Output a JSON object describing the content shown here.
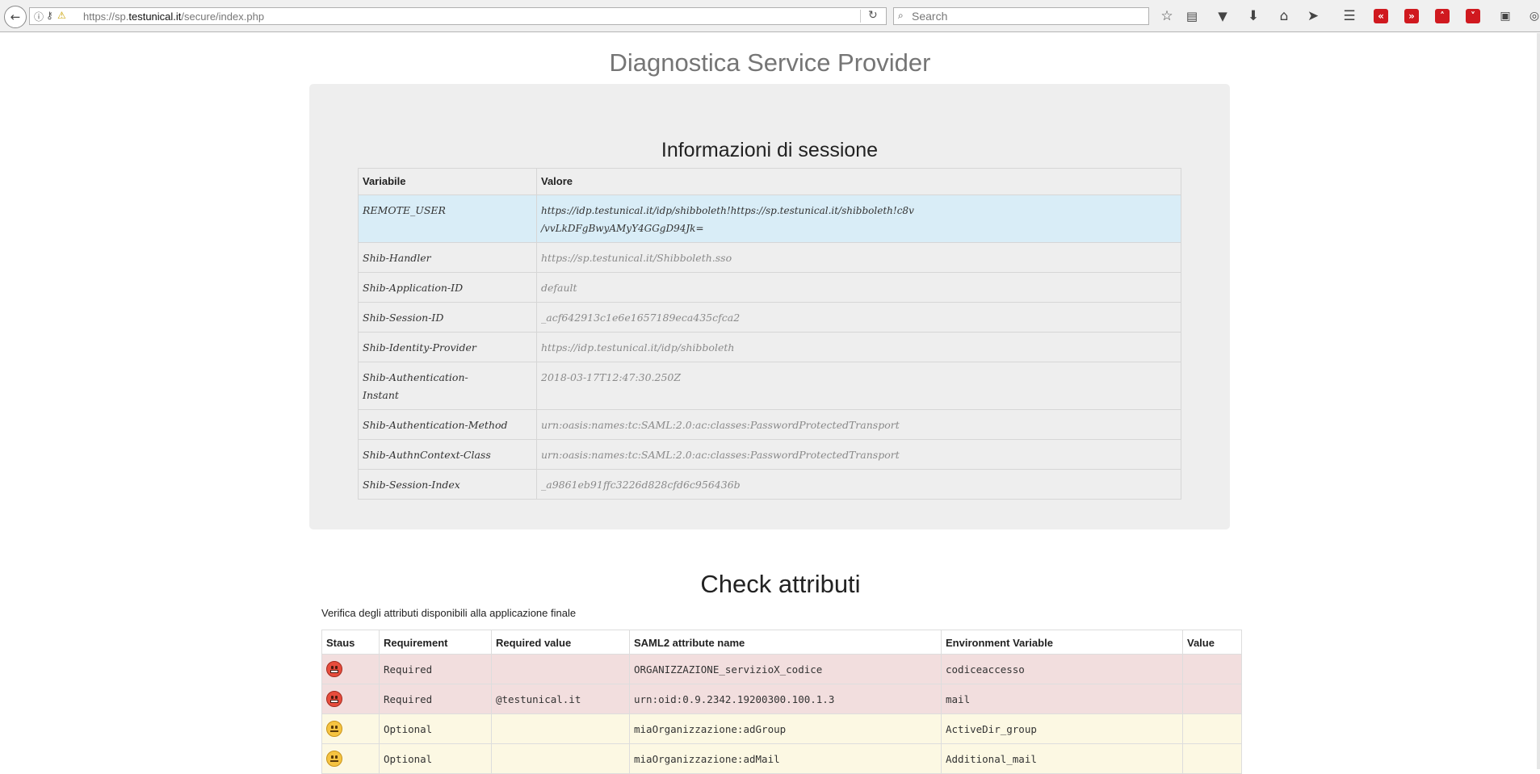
{
  "browser": {
    "url_prefix": "https://sp.",
    "url_host": "testunical.it",
    "url_path": "/secure/index.php",
    "search_placeholder": "Search"
  },
  "page": {
    "title": "Diagnostica Service Provider"
  },
  "session": {
    "heading": "Informazioni di sessione",
    "columns": [
      "Variabile",
      "Valore"
    ],
    "rows": [
      {
        "var": "REMOTE_USER",
        "val": "https://idp.testunical.it/idp/shibboleth!https://sp.testunical.it/shibboleth!c8v\n/vvLkDFgBwyAMyY4GGgD94Jk="
      },
      {
        "var": "Shib-Handler",
        "val": "https://sp.testunical.it/Shibboleth.sso"
      },
      {
        "var": "Shib-Application-ID",
        "val": "default"
      },
      {
        "var": "Shib-Session-ID",
        "val": "_acf642913c1e6e1657189eca435cfca2"
      },
      {
        "var": "Shib-Identity-Provider",
        "val": "https://idp.testunical.it/idp/shibboleth"
      },
      {
        "var": "Shib-Authentication-\nInstant",
        "val": "2018-03-17T12:47:30.250Z"
      },
      {
        "var": "Shib-Authentication-Method",
        "val": "urn:oasis:names:tc:SAML:2.0:ac:classes:PasswordProtectedTransport"
      },
      {
        "var": "Shib-AuthnContext-Class",
        "val": "urn:oasis:names:tc:SAML:2.0:ac:classes:PasswordProtectedTransport"
      },
      {
        "var": "Shib-Session-Index",
        "val": "_a9861eb91ffc3226d828cfd6c956436b"
      }
    ]
  },
  "check": {
    "heading": "Check attributi",
    "subtitle": "Verifica degli attributi disponibili alla applicazione finale",
    "columns": [
      "Staus",
      "Requirement",
      "Required value",
      "SAML2 attribute name",
      "Environment Variable",
      "Value"
    ],
    "rows": [
      {
        "status_icon": "sad-face-icon",
        "requirement": "Required",
        "required_value": "",
        "saml2_name": "ORGANIZZAZIONE_servizioX_codice",
        "env_var": "codiceaccesso",
        "value": ""
      },
      {
        "status_icon": "sad-face-icon",
        "requirement": "Required",
        "required_value": "@testunical.it",
        "saml2_name": "urn:oid:0.9.2342.19200300.100.1.3",
        "env_var": "mail",
        "value": ""
      },
      {
        "status_icon": "neutral-face-icon",
        "requirement": "Optional",
        "required_value": "",
        "saml2_name": "miaOrganizzazione:adGroup",
        "env_var": "ActiveDir_group",
        "value": ""
      },
      {
        "status_icon": "neutral-face-icon",
        "requirement": "Optional",
        "required_value": "",
        "saml2_name": "miaOrganizzazione:adMail",
        "env_var": "Additional_mail",
        "value": ""
      }
    ]
  }
}
